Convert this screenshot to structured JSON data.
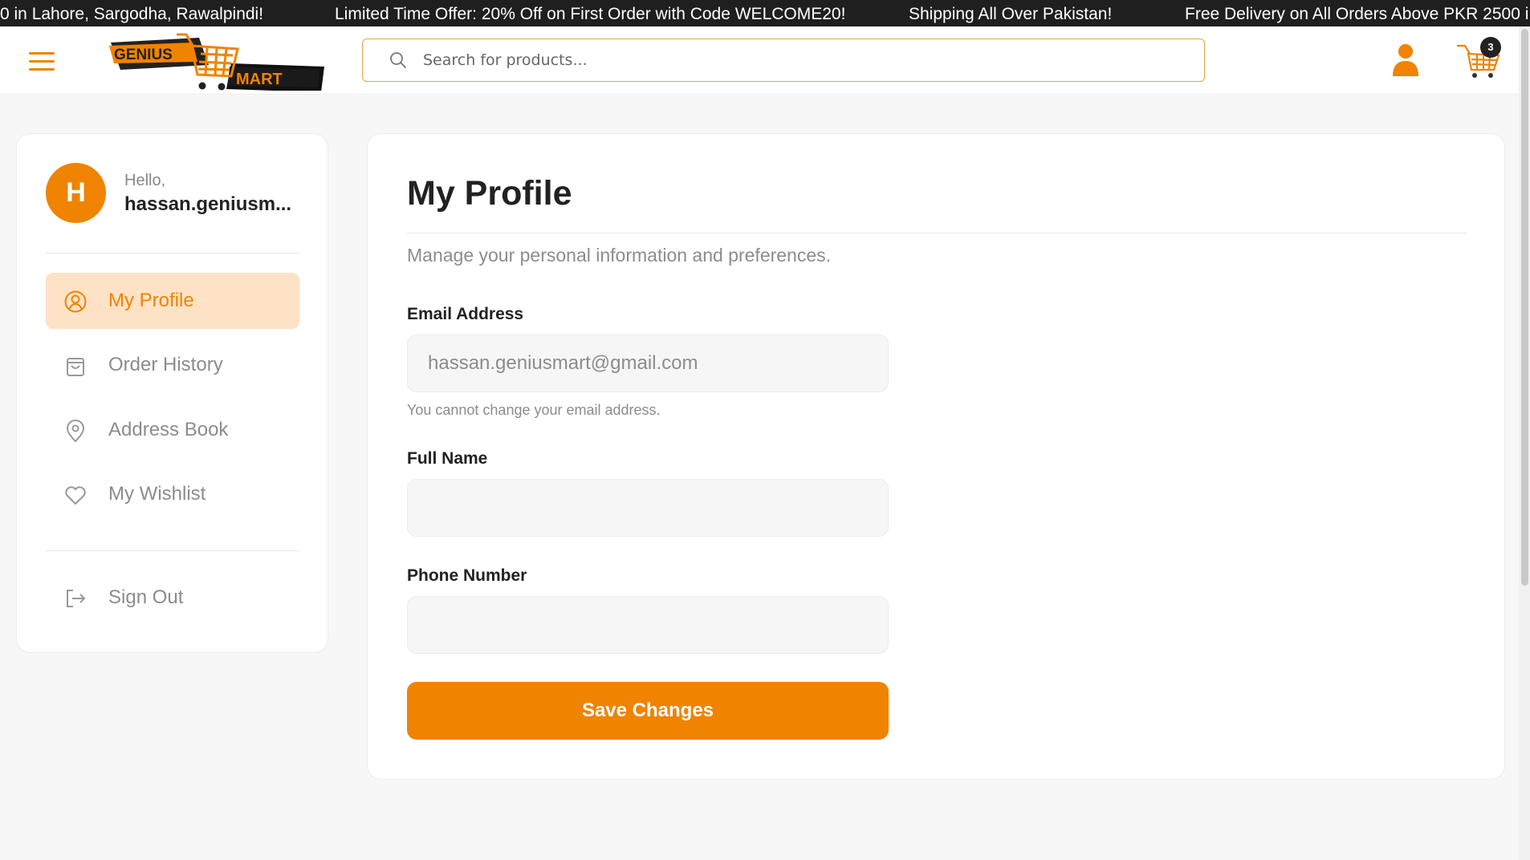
{
  "announcements": [
    "0 in Lahore, Sargodha, Rawalpindi!",
    "Limited Time Offer: 20% Off on First Order with Code WELCOME20!",
    "Shipping All Over Pakistan!",
    "Free Delivery on All Orders Above PKR 2500 i"
  ],
  "header": {
    "search_placeholder": "Search for products...",
    "cart_count": "3"
  },
  "logo": {
    "word1": "GENIUS",
    "word2": "MART"
  },
  "colors": {
    "accent": "#f08300",
    "accent_soft": "#fde2c6",
    "ticker_bg": "#1f1f1f"
  },
  "sidebar": {
    "avatar_initial": "H",
    "greeting": "Hello,",
    "username": "hassan.geniusm...",
    "items": [
      {
        "label": "My Profile",
        "icon": "user-circle-icon",
        "active": true
      },
      {
        "label": "Order History",
        "icon": "shopping-bag-icon",
        "active": false
      },
      {
        "label": "Address Book",
        "icon": "map-pin-icon",
        "active": false
      },
      {
        "label": "My Wishlist",
        "icon": "heart-icon",
        "active": false
      }
    ],
    "signout_label": "Sign Out"
  },
  "profile": {
    "title": "My Profile",
    "subtitle": "Manage your personal information and preferences.",
    "email_label": "Email Address",
    "email_value": "hassan.geniusmart@gmail.com",
    "email_hint": "You cannot change your email address.",
    "name_label": "Full Name",
    "name_value": "",
    "phone_label": "Phone Number",
    "phone_value": "",
    "save_label": "Save Changes"
  }
}
